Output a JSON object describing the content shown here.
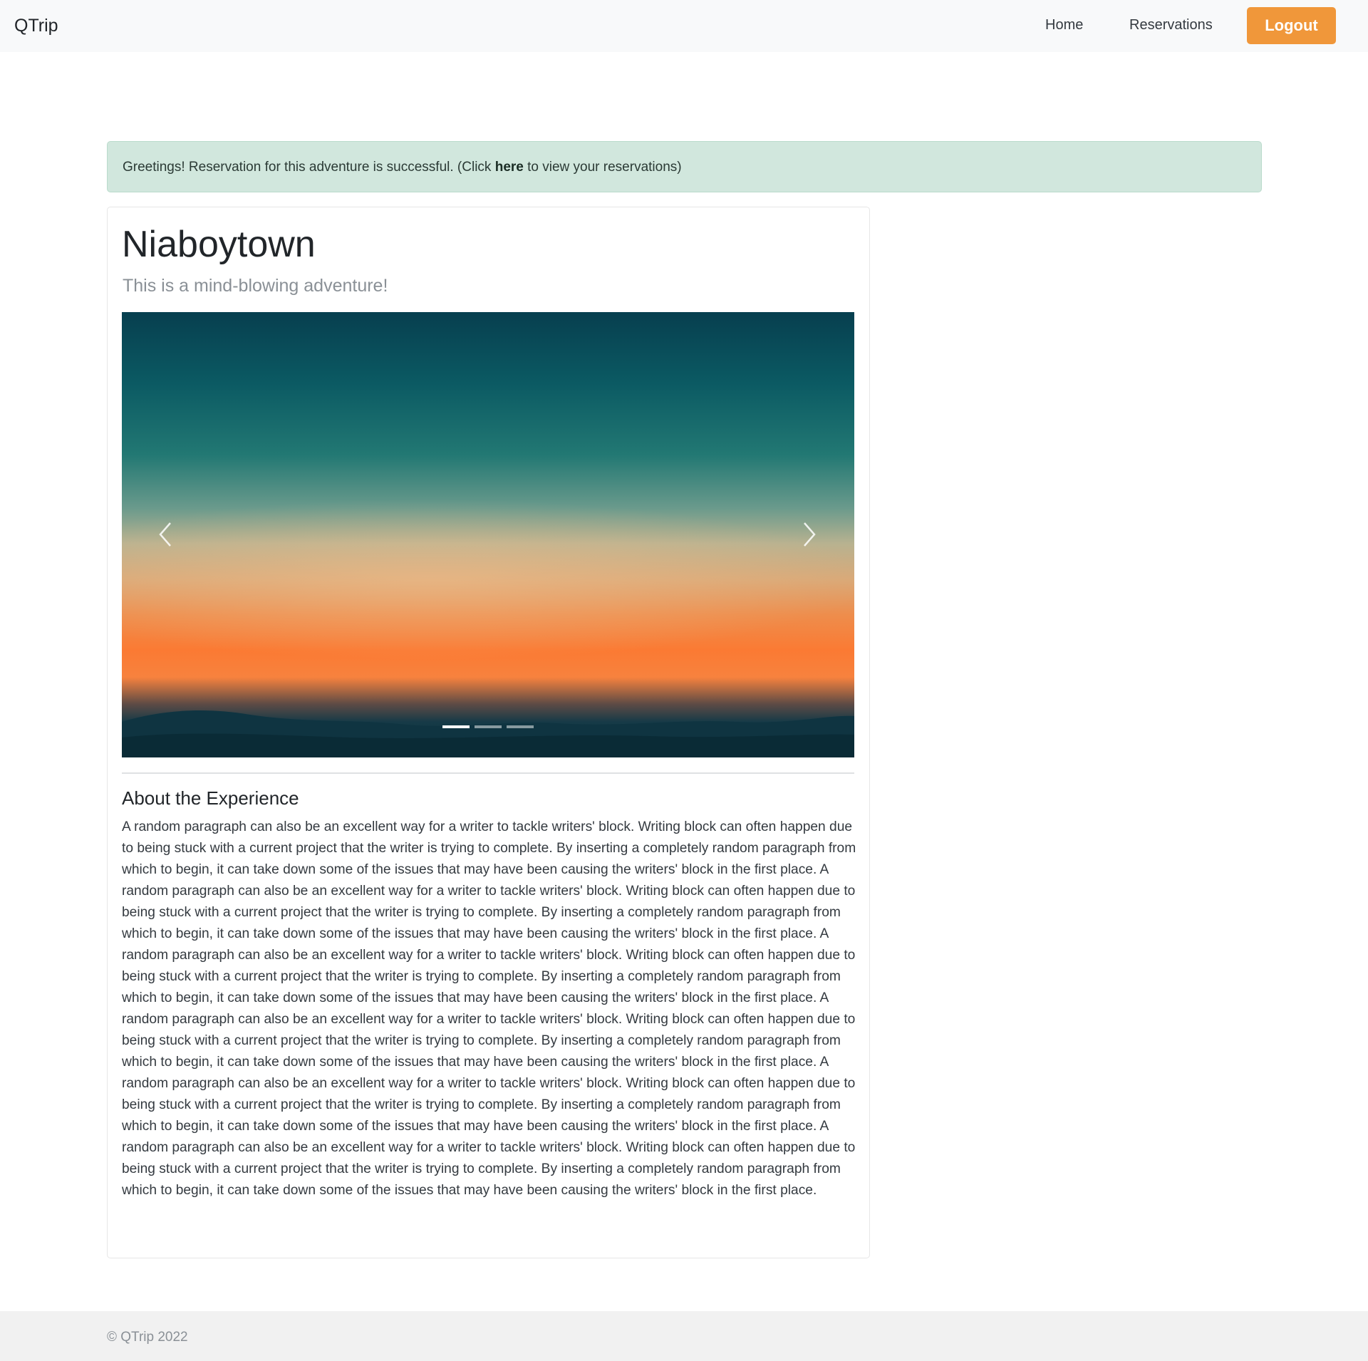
{
  "navbar": {
    "brand": "QTrip",
    "home_label": "Home",
    "reservations_label": "Reservations",
    "logout_label": "Logout"
  },
  "alert": {
    "text_before": "Greetings! Reservation for this adventure is successful. (Click ",
    "link_text": "here",
    "text_after": " to view your reservations)"
  },
  "adventure": {
    "title": "Niaboytown",
    "subtitle": "This is a mind-blowing adventure!",
    "carousel": {
      "slide_count": 3,
      "active_index": 0
    },
    "about_title": "About the Experience",
    "about_text": "A random paragraph can also be an excellent way for a writer to tackle writers' block. Writing block can often happen due to being stuck with a current project that the writer is trying to complete. By inserting a completely random paragraph from which to begin, it can take down some of the issues that may have been causing the writers' block in the first place. A random paragraph can also be an excellent way for a writer to tackle writers' block. Writing block can often happen due to being stuck with a current project that the writer is trying to complete. By inserting a completely random paragraph from which to begin, it can take down some of the issues that may have been causing the writers' block in the first place. A random paragraph can also be an excellent way for a writer to tackle writers' block. Writing block can often happen due to being stuck with a current project that the writer is trying to complete. By inserting a completely random paragraph from which to begin, it can take down some of the issues that may have been causing the writers' block in the first place. A random paragraph can also be an excellent way for a writer to tackle writers' block. Writing block can often happen due to being stuck with a current project that the writer is trying to complete. By inserting a completely random paragraph from which to begin, it can take down some of the issues that may have been causing the writers' block in the first place. A random paragraph can also be an excellent way for a writer to tackle writers' block. Writing block can often happen due to being stuck with a current project that the writer is trying to complete. By inserting a completely random paragraph from which to begin, it can take down some of the issues that may have been causing the writers' block in the first place. A random paragraph can also be an excellent way for a writer to tackle writers' block. Writing block can often happen due to being stuck with a current project that the writer is trying to complete. By inserting a completely random paragraph from which to begin, it can take down some of the issues that may have been causing the writers' block in the first place."
  },
  "footer": {
    "text": "© QTrip 2022"
  },
  "colors": {
    "accent": "#f0973a",
    "alert_bg": "#d1e7dd",
    "navbar_bg": "#f8f9fa",
    "footer_bg": "#f1f1f1"
  },
  "icons": {
    "prev": "chevron-left-icon",
    "next": "chevron-right-icon"
  }
}
